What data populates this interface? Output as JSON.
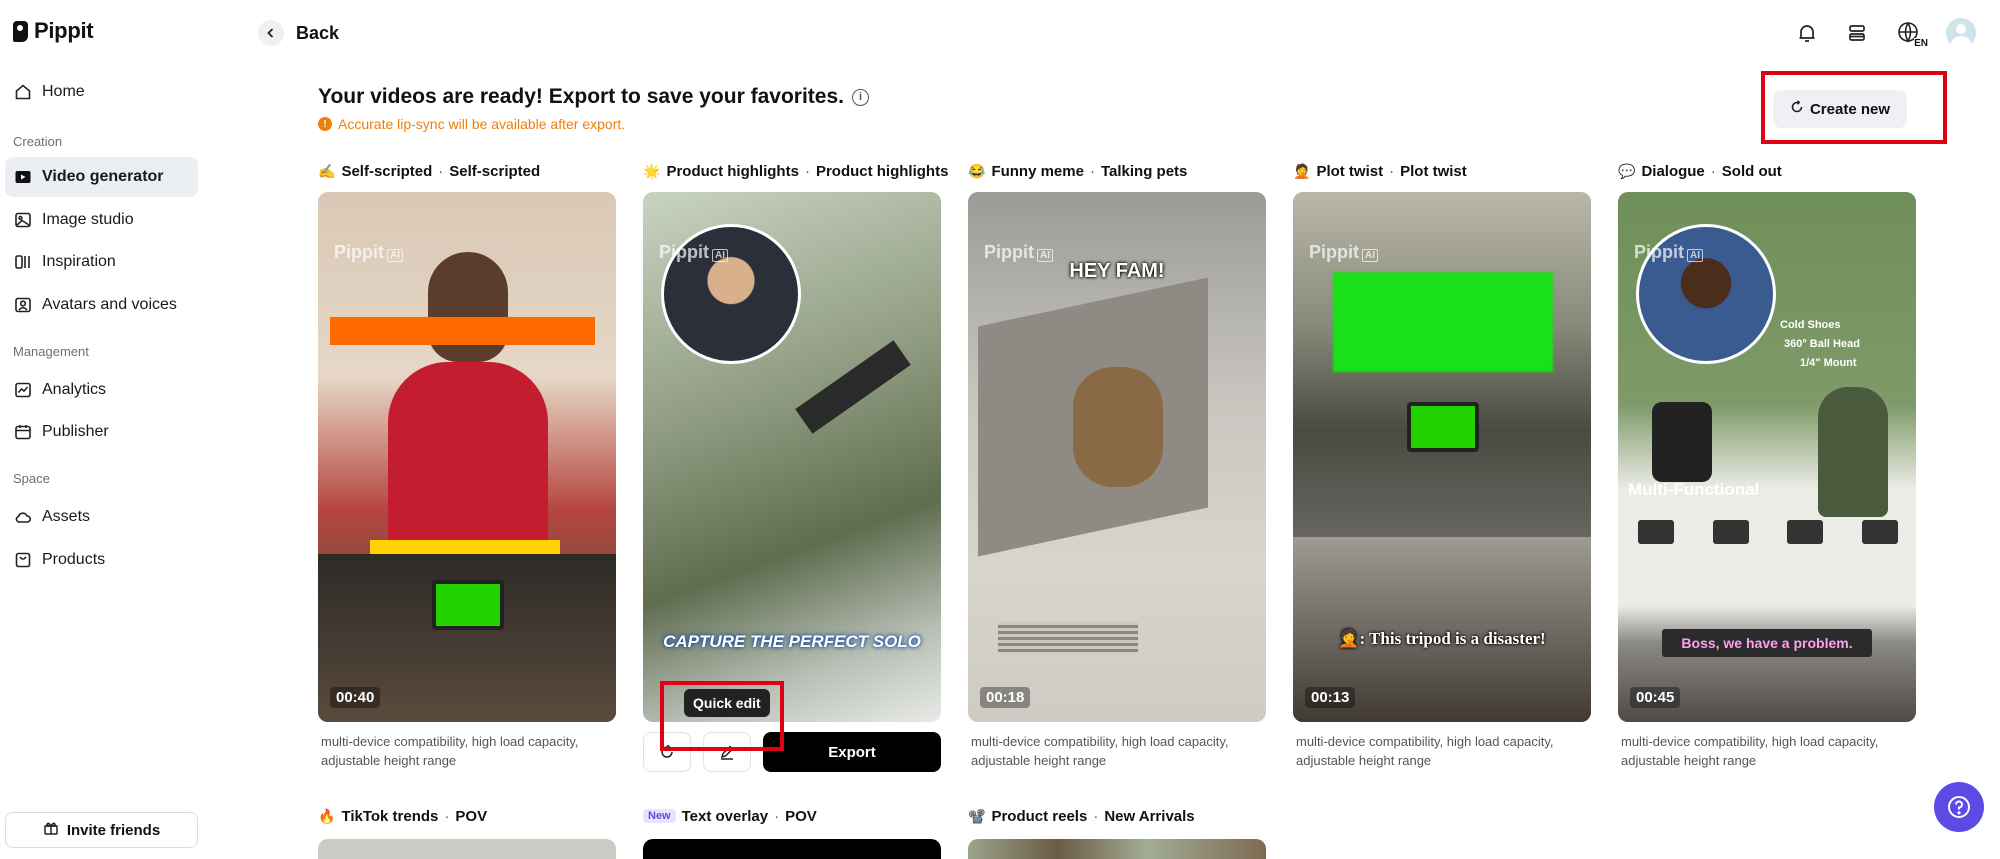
{
  "app": {
    "name": "Pippit"
  },
  "sidebar": {
    "items_top": [
      {
        "label": "Home",
        "icon": "home-icon"
      }
    ],
    "sections": [
      {
        "title": "Creation",
        "items": [
          {
            "label": "Video generator",
            "icon": "video-generator-icon",
            "active": true
          },
          {
            "label": "Image studio",
            "icon": "image-icon"
          },
          {
            "label": "Inspiration",
            "icon": "inspiration-icon"
          },
          {
            "label": "Avatars and voices",
            "icon": "avatar-icon"
          }
        ]
      },
      {
        "title": "Management",
        "items": [
          {
            "label": "Analytics",
            "icon": "analytics-icon"
          },
          {
            "label": "Publisher",
            "icon": "calendar-icon"
          }
        ]
      },
      {
        "title": "Space",
        "items": [
          {
            "label": "Assets",
            "icon": "cloud-icon"
          },
          {
            "label": "Products",
            "icon": "products-icon"
          }
        ]
      }
    ],
    "invite_label": "Invite friends"
  },
  "topbar": {
    "back_label": "Back",
    "lang_label": "EN"
  },
  "header": {
    "title": "Your videos are ready! Export to save your favorites.",
    "warning": "Accurate lip-sync will be available after export.",
    "create_new_label": "Create new"
  },
  "cards": [
    {
      "emoji": "✍️",
      "category": "Self-scripted",
      "style": "Self-scripted",
      "duration": "00:40",
      "description": "multi-device compatibility, high load capacity, adjustable height range",
      "watermark": "Pippit"
    },
    {
      "emoji": "🌟",
      "category": "Product highlights",
      "style": "Product highlights",
      "overlay": "CAPTURE THE PERFECT SOLO",
      "watermark": "Pippit",
      "tooltip": "Quick edit",
      "export_label": "Export"
    },
    {
      "emoji": "😂",
      "category": "Funny meme",
      "style": "Talking pets",
      "duration": "00:18",
      "overlay": "HEY FAM!",
      "description": "multi-device compatibility, high load capacity, adjustable height range",
      "watermark": "Pippit"
    },
    {
      "emoji": "🤦",
      "category": "Plot twist",
      "style": "Plot twist",
      "duration": "00:13",
      "overlay": ": This tripod is a disaster!",
      "description": "multi-device compatibility, high load capacity, adjustable height range",
      "watermark": "Pippit"
    },
    {
      "emoji": "💬",
      "category": "Dialogue",
      "style": "Sold out",
      "duration": "00:45",
      "overlay": "Boss, we have a problem.",
      "overlay_top": "Multi-Functional",
      "spec_lines": [
        "Cold Shoes",
        "360° Ball Head",
        "1/4\" Mount"
      ],
      "description": "multi-device compatibility, high load capacity, adjustable height range",
      "watermark": "Pippit"
    }
  ],
  "cards_row2": [
    {
      "emoji": "🔥",
      "category": "TikTok trends",
      "style": "POV"
    },
    {
      "tag": "New",
      "category": "Text overlay",
      "style": "POV"
    },
    {
      "emoji": "📽️",
      "category": "Product reels",
      "style": "New Arrivals"
    }
  ],
  "colors": {
    "accent_red": "#e00014",
    "warning_orange": "#ef7f0c",
    "help_purple": "#5b4ae6"
  }
}
